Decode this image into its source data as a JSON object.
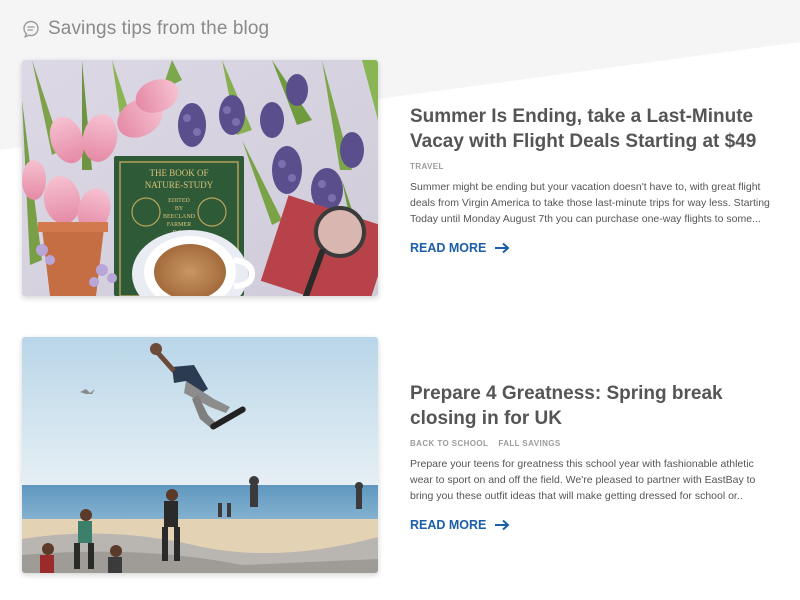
{
  "section": {
    "title": "Savings tips from the blog",
    "icon": "speech-bubble-icon"
  },
  "posts": [
    {
      "title": "Summer Is Ending, take a Last-Minute Vacay with Flight Deals Starting at $49",
      "tags": [
        "TRAVEL"
      ],
      "excerpt": "Summer might be ending but your vacation doesn't have to, with great flight deals from Virgin America to take those last-minute trips for way less. Starting Today until Monday August 7th you can purchase one-way flights to some...",
      "read_more": "READ MORE",
      "image": {
        "alt": "flatlay with tulips, book, tea and magnifying glass",
        "book_title_1": "THE BOOK OF",
        "book_title_2": "NATURE-STUDY",
        "book_sub_1": "EDITED",
        "book_sub_2": "BY",
        "book_sub_3": "BEECLAND",
        "book_sub_4": "FARMER",
        "book_sub_5": "D.Sc."
      }
    },
    {
      "title": "Prepare 4 Greatness: Spring break closing in for UK",
      "tags": [
        "BACK TO SCHOOL",
        "FALL SAVINGS"
      ],
      "excerpt": "Prepare your teens for greatness this school year with fashionable athletic wear to sport on and off the field. We're pleased to partner with EastBay to bring you these outfit ideas that will make getting dressed for school or..",
      "read_more": "READ MORE",
      "image": {
        "alt": "skateboarder at the beach skatepark"
      }
    }
  ],
  "colors": {
    "link": "#1c5fa8",
    "title": "#555555",
    "tag": "#9b9b9b",
    "header_text": "#8a8a8a",
    "band": "#f5f5f6"
  }
}
